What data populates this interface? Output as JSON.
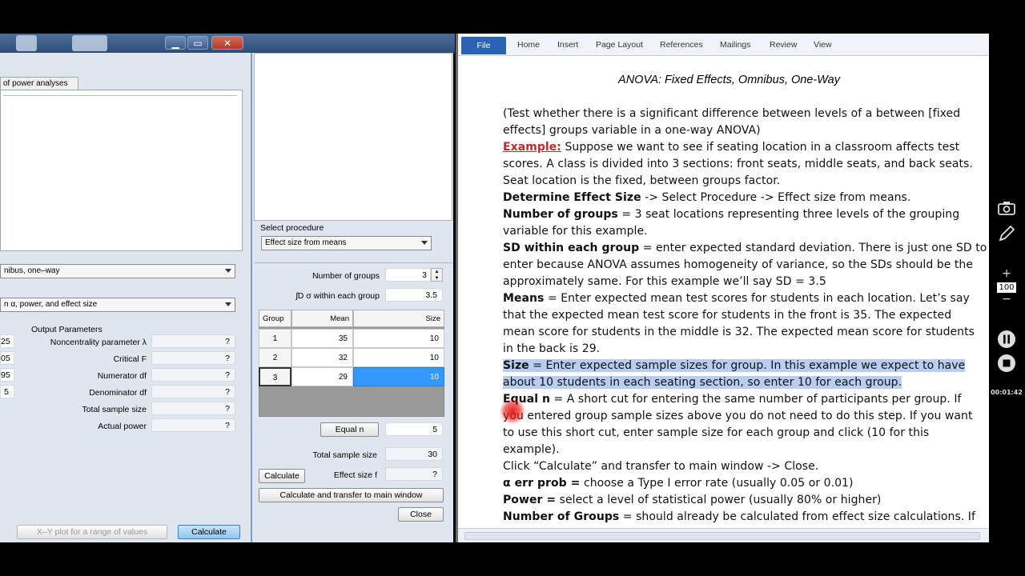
{
  "gpower": {
    "tab_label": "of power analyses",
    "test_combo": "nibus, one–way",
    "analysis_combo": "n α, power, and effect size",
    "input_values": [
      "25",
      "05",
      "95",
      "5"
    ],
    "output_header": "Output Parameters",
    "outputs": [
      {
        "label": "Noncentrality parameter λ",
        "value": "?"
      },
      {
        "label": "Critical F",
        "value": "?"
      },
      {
        "label": "Numerator df",
        "value": "?"
      },
      {
        "label": "Denominator df",
        "value": "?"
      },
      {
        "label": "Total sample size",
        "value": "?"
      },
      {
        "label": "Actual power",
        "value": "?"
      }
    ],
    "xy_button": "X–Y plot for a range of values",
    "calculate_button": "Calculate"
  },
  "effect_dialog": {
    "select_procedure_label": "Select procedure",
    "procedure_value": "Effect size from means",
    "num_groups_label": "Number of groups",
    "num_groups_value": "3",
    "sd_label": "ʃD σ within each group",
    "sd_value": "3.5",
    "table_headers": [
      "Group",
      "Mean",
      "Size"
    ],
    "rows": [
      {
        "group": "1",
        "mean": "35",
        "size": "10"
      },
      {
        "group": "2",
        "mean": "32",
        "size": "10"
      },
      {
        "group": "3",
        "mean": "29",
        "size": "10"
      }
    ],
    "equal_n_button": "Equal n",
    "equal_n_value": "5",
    "total_label": "Total sample size",
    "total_value": "30",
    "calculate_button": "Calculate",
    "effect_f_label": "Effect size f",
    "effect_f_value": "?",
    "transfer_button": "Calculate and transfer to main window",
    "close_button": "Close"
  },
  "word": {
    "tabs": [
      "File",
      "Home",
      "Insert",
      "Page Layout",
      "References",
      "Mailings",
      "Review",
      "View"
    ],
    "title": "ANOVA: Fixed Effects, Omnibus, One-Way",
    "text": {
      "l1": "(Test whether there is a significant difference  between levels of a between [fixed",
      "l2": "effects]  groups variable in a one-way ANOVA)",
      "ex_word": "Example:",
      "l3": " Suppose we want to see if seating location in a classroom affects test",
      "l4": "scores. A class is divided into 3 sections: front seats, middle seats, and back seats.",
      "l5": "Seat location is the fixed, between groups factor.",
      "l6b": "Determine  Effect Size",
      "l6": " -> Select Procedure -> Effect size from means.",
      "l7b": "Number of groups",
      "l7": " = 3 seat locations representing  three levels of the grouping",
      "l8": "variable for this example.",
      "l9b": "SD within each group",
      "l9": " = enter expected standard deviation. There is just one SD to",
      "l10": "enter because ANOVA assumes homogeneity of variance, so the SDs should be the",
      "l11": "approximately same. For this example we’ll say SD = 3.5",
      "l12b": "Means",
      "l12": " = Enter expected mean test scores for students in each location. Let’s say",
      "l13": "that the expected mean test score for students  in the front is 35. The expected",
      "l14": "mean score for students  in the middle is 32. The expected mean score for students",
      "l15": "in the back is 29.",
      "l16b": "Size",
      "l16": " = Enter expected sample sizes for group. In this example we expect to have",
      "l17": "about 10 students in each seating section, so enter 10 for each group.",
      "l18b": "Equal  n",
      "l18": " = A short cut for entering the same number of participants per group.  If",
      "l19": "you entered group sample sizes above you do not need to do this step. If you want",
      "l20": "to use this short cut, enter sample size for each group and click (10 for this",
      "l21": "example).",
      "l22": "Click “Calculate” and transfer to main window -> Close.",
      "l23b": "α err prob =",
      "l23": " choose a Type I error rate (usually 0.05 or 0.01)",
      "l24b": "Power =",
      "l24": " select a level of statistical power (usually 80% or higher)",
      "l25b": "Number of Groups",
      "l25": " = should already be calculated from effect size calculations.  If"
    }
  },
  "recorder": {
    "zoom": "100",
    "timer": "00:01:42",
    "icons": [
      "camera-icon",
      "pen-icon",
      "plus-icon",
      "minus-icon",
      "pause-icon",
      "stop-icon"
    ]
  }
}
